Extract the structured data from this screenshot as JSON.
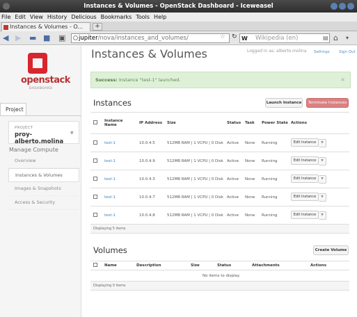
{
  "window": {
    "title": "Instances & Volumes - OpenStack Dashboard - Iceweasel"
  },
  "menu": [
    "File",
    "Edit",
    "View",
    "History",
    "Delicious",
    "Bookmarks",
    "Tools",
    "Help"
  ],
  "tab": {
    "label": "Instances & Volumes - O...",
    "new_tab": "+"
  },
  "nav": {
    "url_host": "jupiter",
    "url_path": "/nova/instances_and_volumes/",
    "search_engine": "W",
    "search_placeholder": "Wikipedia (en)"
  },
  "sidebar": {
    "logo_word": "openstack",
    "logo_sub": "DASHBOARD",
    "tab": "Project",
    "project_label": "PROJECT",
    "project_name": "proy-alberto.molina",
    "section": "Manage Compute",
    "items": [
      {
        "label": "Overview"
      },
      {
        "label": "Instances & Volumes"
      },
      {
        "label": "Images & Snapshots"
      },
      {
        "label": "Access & Security"
      }
    ]
  },
  "header": {
    "title": "Instances & Volumes",
    "logged_in": "Logged in as: alberto.molina",
    "settings": "Settings",
    "sign_out": "Sign Out"
  },
  "alert": {
    "strong": "Success:",
    "text": "Instance \"test-1\" launched.",
    "close": "×"
  },
  "instances": {
    "title": "Instances",
    "launch": "Launch Instance",
    "terminate": "Terminate Instances",
    "columns": [
      "Instance Name",
      "IP Address",
      "Size",
      "Status",
      "Task",
      "Power State",
      "Actions"
    ],
    "rows": [
      {
        "name": "test-1",
        "ip": "10.0.4.5",
        "size": "512MB RAM | 1 VCPU | 0 Disk",
        "status": "Active",
        "task": "None",
        "power": "Running",
        "action": "Edit Instance"
      },
      {
        "name": "test-1",
        "ip": "10.0.4.9",
        "size": "512MB RAM | 1 VCPU | 0 Disk",
        "status": "Active",
        "task": "None",
        "power": "Running",
        "action": "Edit Instance"
      },
      {
        "name": "test-1",
        "ip": "10.0.4.3",
        "size": "512MB RAM | 1 VCPU | 0 Disk",
        "status": "Active",
        "task": "None",
        "power": "Running",
        "action": "Edit Instance"
      },
      {
        "name": "test-1",
        "ip": "10.0.4.7",
        "size": "512MB RAM | 1 VCPU | 0 Disk",
        "status": "Active",
        "task": "None",
        "power": "Running",
        "action": "Edit Instance"
      },
      {
        "name": "test-1",
        "ip": "10.0.4.8",
        "size": "512MB RAM | 1 VCPU | 0 Disk",
        "status": "Active",
        "task": "None",
        "power": "Running",
        "action": "Edit Instance"
      }
    ],
    "footer": "Displaying 5 items"
  },
  "volumes": {
    "title": "Volumes",
    "create": "Create Volume",
    "columns": [
      "Name",
      "Description",
      "Size",
      "Status",
      "Attachments",
      "Actions"
    ],
    "empty": "No items to display.",
    "footer": "Displaying 0 items"
  },
  "colors": {
    "brand_red": "#d8262e",
    "terminate": "#da8182",
    "link": "#3b84c4",
    "success_bg": "#dff0d8"
  }
}
